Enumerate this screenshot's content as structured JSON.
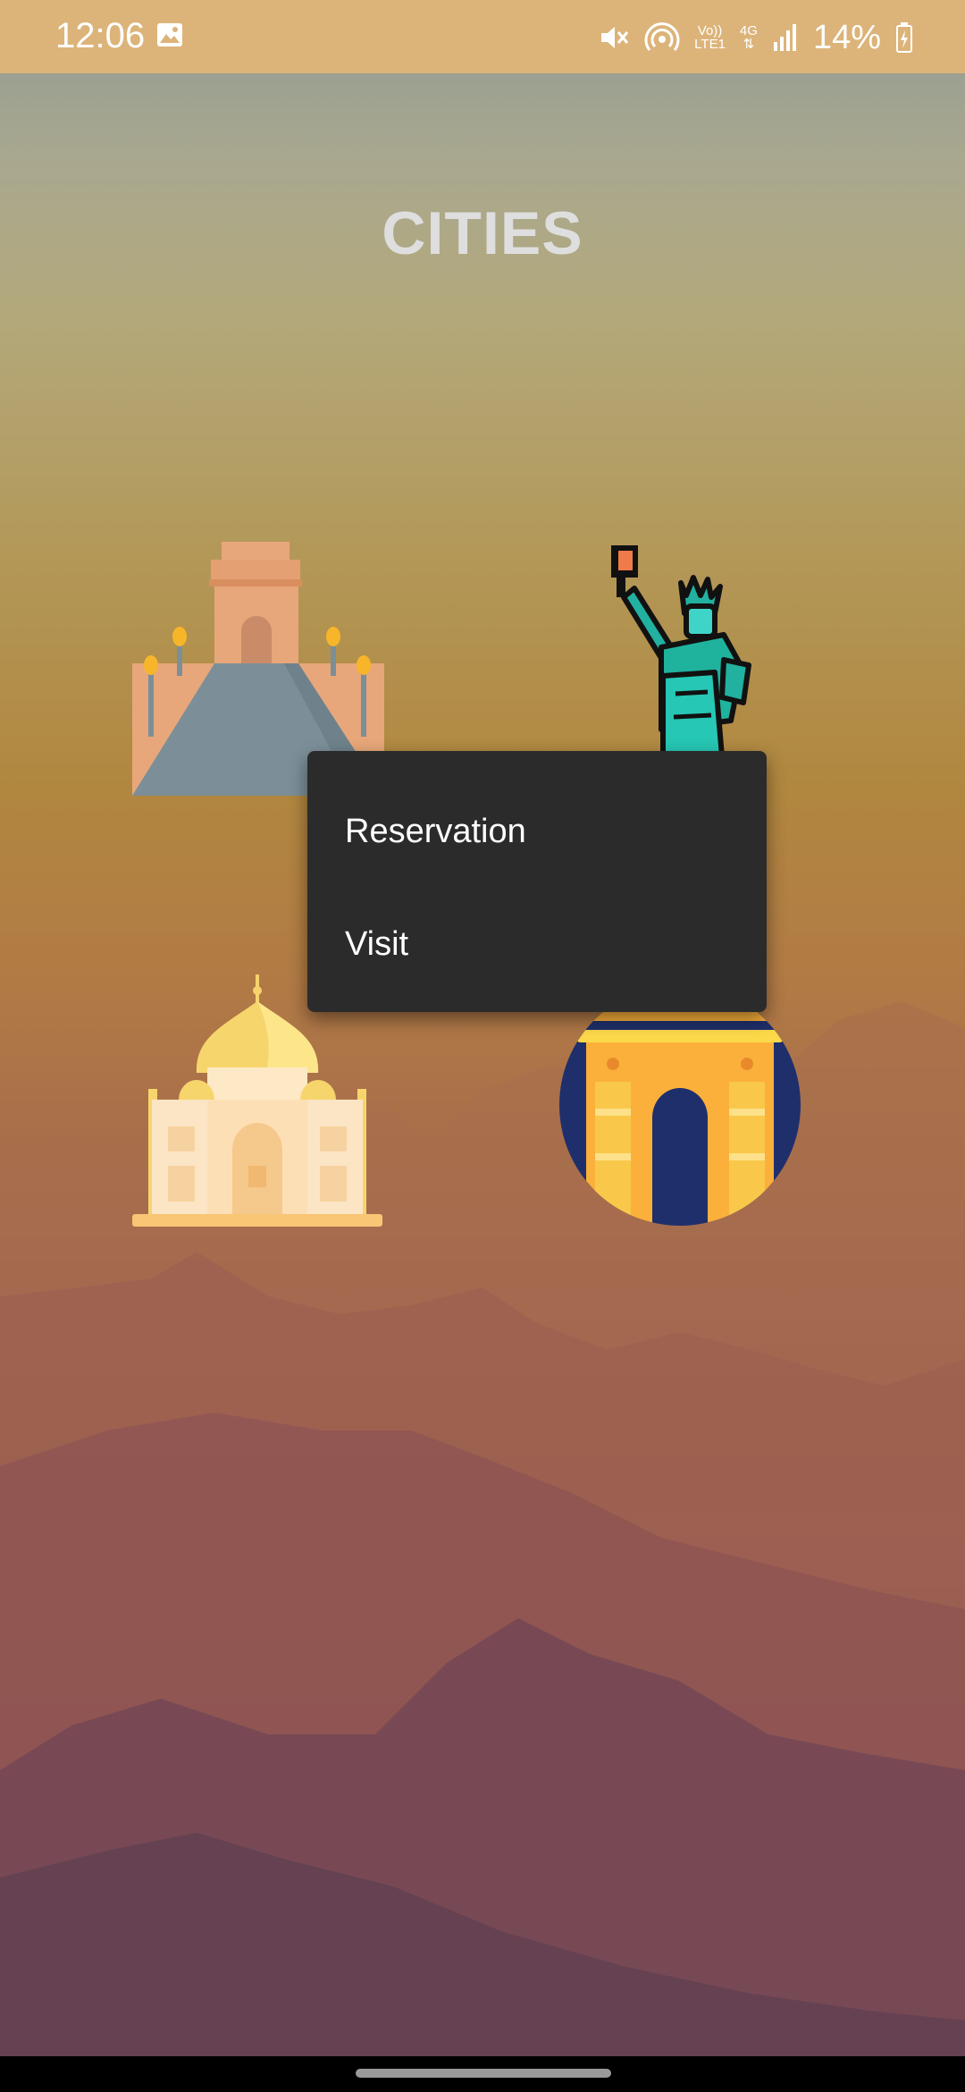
{
  "status_bar": {
    "time": "12:06",
    "network_top": "Vo))",
    "network_bottom": "LTE1",
    "net_type": "4G",
    "battery": "14%",
    "icons": [
      "image-icon",
      "mute-icon",
      "hotspot-icon",
      "signal-icon",
      "battery-charging-icon"
    ],
    "bg_color": "#dcb47a"
  },
  "page": {
    "title": "CITIES"
  },
  "landmarks": [
    {
      "icon": "gate-monument-icon"
    },
    {
      "icon": "statue-of-liberty-icon"
    },
    {
      "icon": "taj-mahal-icon"
    },
    {
      "icon": "india-gate-icon"
    }
  ],
  "context_menu": {
    "items": [
      {
        "label": "Reservation"
      },
      {
        "label": "Visit"
      }
    ],
    "bg_color": "#2b2b2b"
  }
}
